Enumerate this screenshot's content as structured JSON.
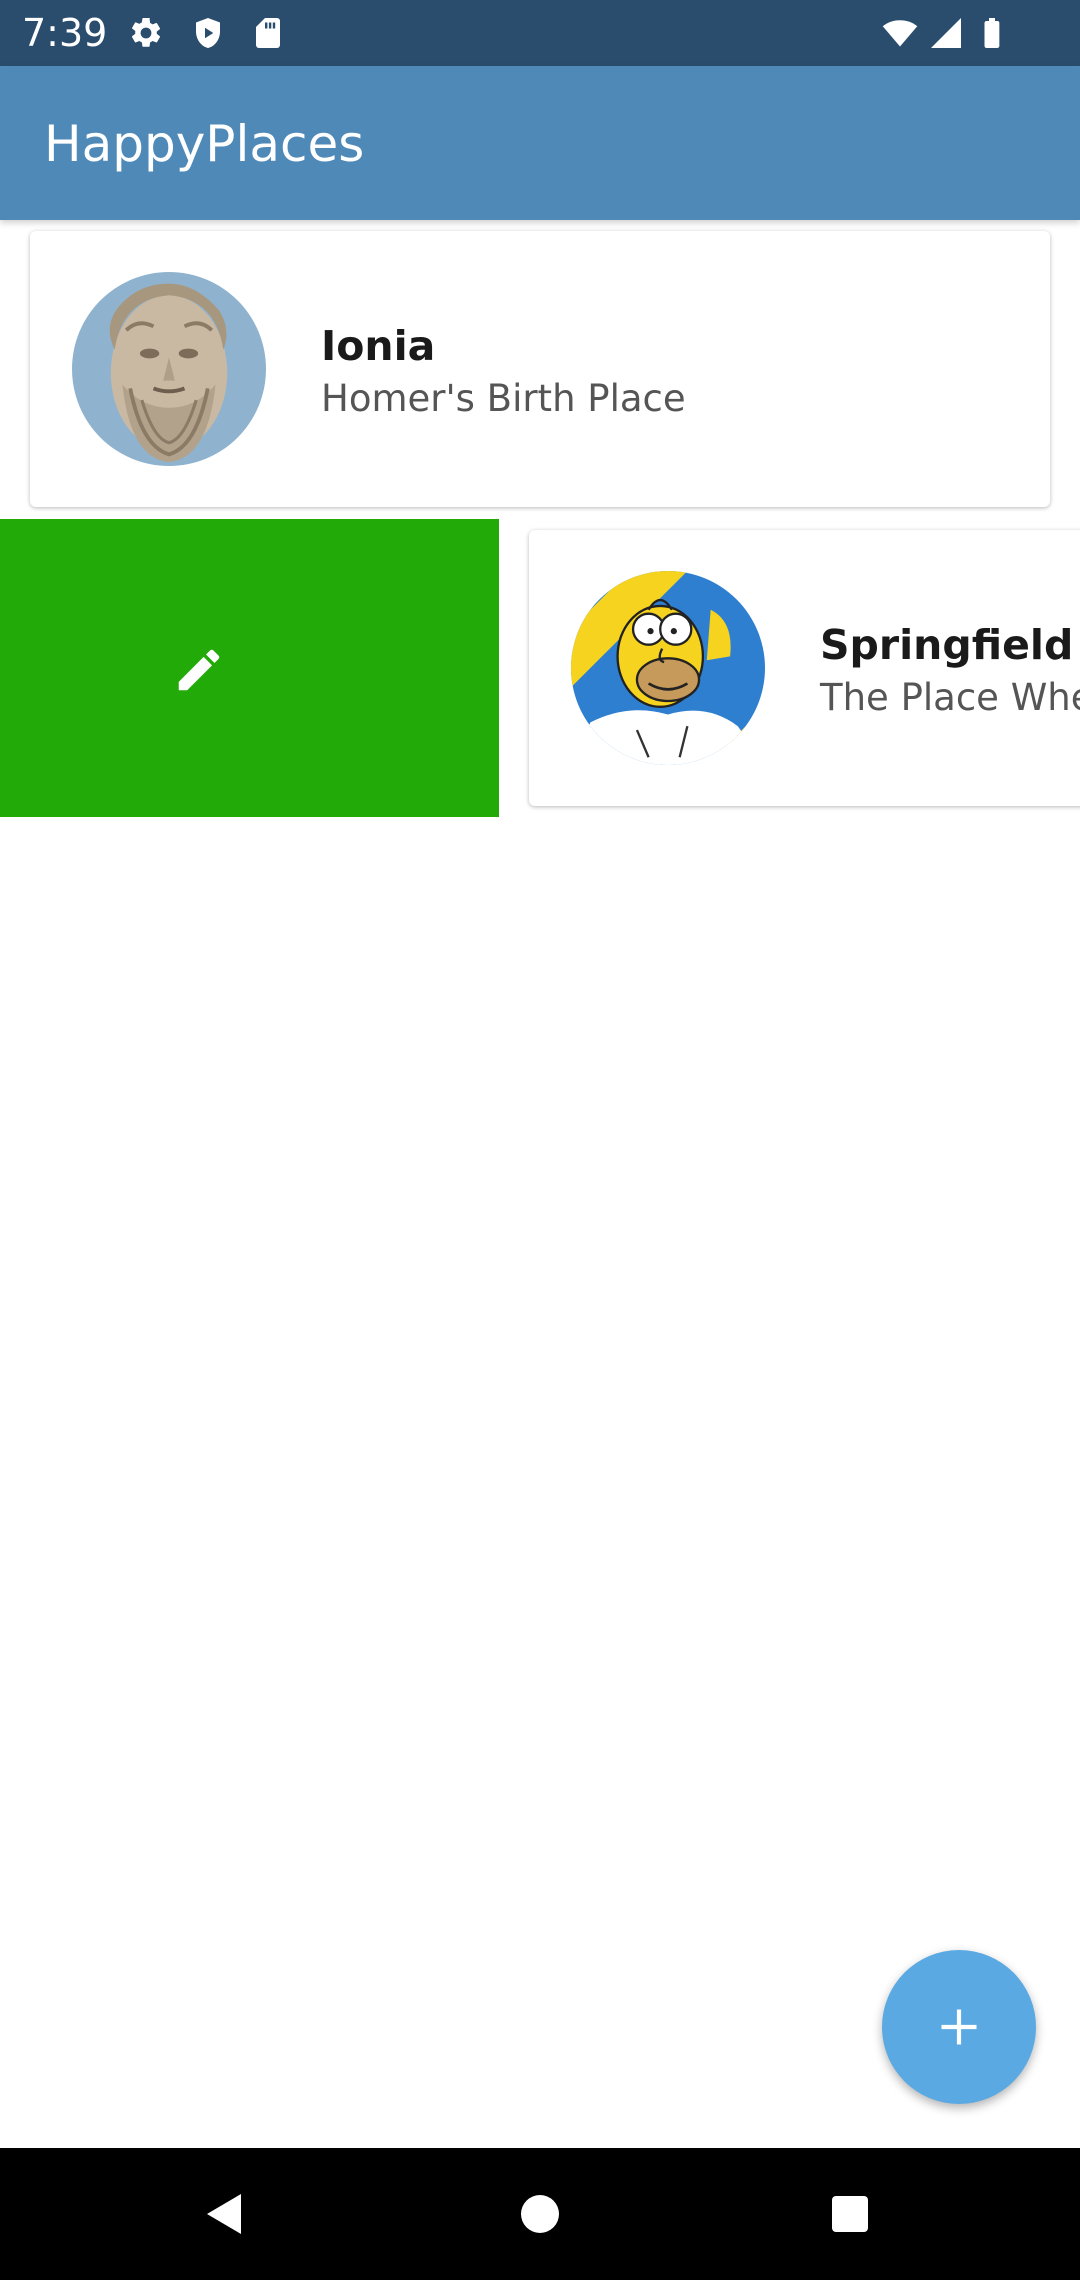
{
  "status_bar": {
    "time": "7:39",
    "icons": [
      "settings-icon",
      "shield-icon",
      "sd-card-icon",
      "wifi-icon",
      "signal-icon",
      "battery-icon"
    ],
    "background": "#2a4d6d"
  },
  "app_bar": {
    "title": "HappyPlaces",
    "background": "#4f89b8"
  },
  "places": [
    {
      "title": "Ionia",
      "description": "Homer's Birth Place",
      "image": "homer-bust-avatar"
    },
    {
      "title": "Springfield",
      "description": "The Place Whe",
      "image": "homer-simpson-avatar"
    }
  ],
  "swipe_action": {
    "icon": "edit-icon",
    "color": "#22aa08"
  },
  "fab": {
    "icon": "plus-icon",
    "color": "#5aa9e3"
  },
  "nav_bar": {
    "buttons": [
      "back-icon",
      "home-icon",
      "recents-icon"
    ]
  }
}
